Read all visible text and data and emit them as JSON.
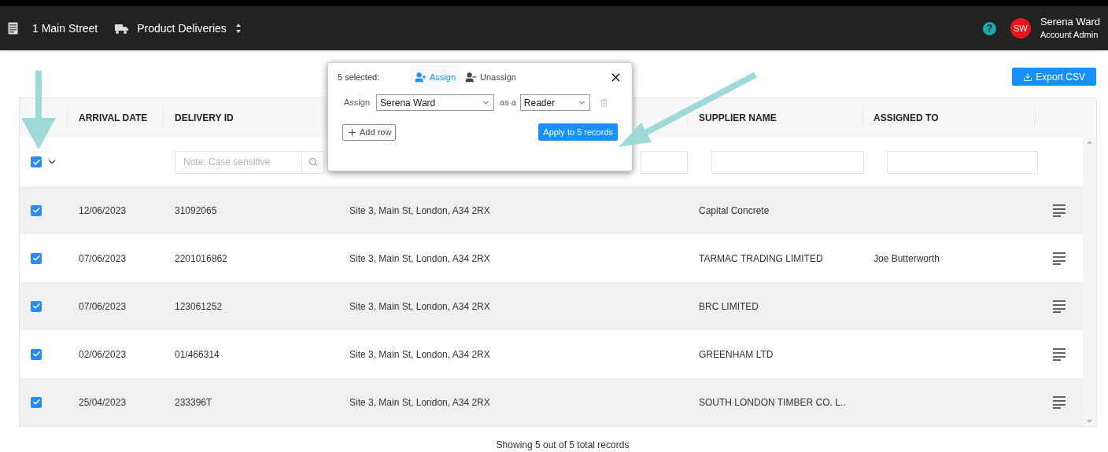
{
  "nav": {
    "location": "1 Main Street",
    "module": "Product Deliveries"
  },
  "user": {
    "name": "Serena Ward",
    "role": "Account Admin",
    "initials": "SW"
  },
  "help_glyph": "?",
  "export_button": "Export CSV",
  "columns": [
    "ARRIVAL DATE",
    "DELIVERY ID",
    "SUPPLIER NAME",
    "ASSIGNED TO"
  ],
  "select_all": {
    "checked": true
  },
  "filter_placeholder": "Note: Case sensitive",
  "rows": [
    {
      "checked": true,
      "arrival_date": "12/06/2023",
      "delivery_id": "31092065",
      "address": "Site 3, Main St, London, A34 2RX",
      "supplier": "Capital Concrete",
      "assigned_to": ""
    },
    {
      "checked": true,
      "arrival_date": "07/06/2023",
      "delivery_id": "2201016862",
      "address": "Site 3, Main St, London, A34 2RX",
      "supplier": "TARMAC TRADING LIMITED",
      "assigned_to": "Joe Butterworth"
    },
    {
      "checked": true,
      "arrival_date": "07/06/2023",
      "delivery_id": "123061252",
      "address": "Site 3, Main St, London, A34 2RX",
      "supplier": "BRC LIMITED",
      "assigned_to": ""
    },
    {
      "checked": true,
      "arrival_date": "02/06/2023",
      "delivery_id": "01/466314",
      "address": "Site 3, Main St, London, A34 2RX",
      "supplier": "GREENHAM LTD",
      "assigned_to": ""
    },
    {
      "checked": true,
      "arrival_date": "25/04/2023",
      "delivery_id": "233396T",
      "address": "Site 3, Main St, London, A34 2RX",
      "supplier": "SOUTH LONDON TIMBER CO. L..",
      "assigned_to": ""
    }
  ],
  "footer": "Showing 5 out of 5 total records",
  "popup": {
    "count_label": "5 selected:",
    "tabs": [
      {
        "label": "Assign",
        "selected": true
      },
      {
        "label": "Unassign",
        "selected": false
      }
    ],
    "assign_label": "Assign",
    "user_select": "Serena Ward",
    "as_label": "as a",
    "role_select": "Reader",
    "add_row": "Add row",
    "apply": "Apply to 5 records"
  }
}
